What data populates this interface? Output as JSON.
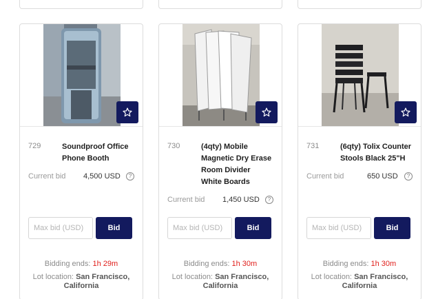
{
  "lots": [
    {
      "lot_number": "729",
      "title_lines": [
        "Soundproof Office",
        "Phone Booth"
      ],
      "current_bid_label": "Current bid",
      "current_bid": "4,500 USD",
      "help_icon": "?",
      "max_bid_placeholder": "Max bid (USD)",
      "bid_button": "Bid",
      "favorite_icon": "star-icon",
      "bidding_ends_label": "Bidding ends:",
      "bidding_ends_time": "1h 29m",
      "location_label": "Lot location:",
      "location_line1": "San Francisco,",
      "location_line2": "California"
    },
    {
      "lot_number": "730",
      "title_lines": [
        "(4qty) Mobile",
        "Magnetic Dry Erase",
        "Room Divider",
        "White Boards"
      ],
      "current_bid_label": "Current bid",
      "current_bid": "1,450 USD",
      "help_icon": "?",
      "max_bid_placeholder": "Max bid (USD)",
      "bid_button": "Bid",
      "favorite_icon": "star-icon",
      "bidding_ends_label": "Bidding ends:",
      "bidding_ends_time": "1h 30m",
      "location_label": "Lot location:",
      "location_line1": "San Francisco,",
      "location_line2": "California"
    },
    {
      "lot_number": "731",
      "title_lines": [
        "(6qty) Tolix Counter",
        "Stools Black 25\"H"
      ],
      "current_bid_label": "Current bid",
      "current_bid": "650 USD",
      "help_icon": "?",
      "max_bid_placeholder": "Max bid (USD)",
      "bid_button": "Bid",
      "favorite_icon": "star-icon",
      "bidding_ends_label": "Bidding ends:",
      "bidding_ends_time": "1h 30m",
      "location_label": "Lot location:",
      "location_line1": "San Francisco,",
      "location_line2": "California"
    }
  ],
  "colors": {
    "accent": "#131a5e",
    "ends_time": "#e0201c",
    "muted_text": "#8b8b8b",
    "border": "#dcdcdc"
  }
}
